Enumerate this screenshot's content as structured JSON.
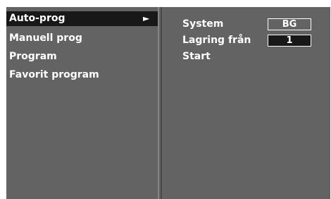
{
  "menu": {
    "items": [
      {
        "label": "Auto-prog",
        "selected": true,
        "arrow": "►"
      },
      {
        "label": "Manuell prog"
      },
      {
        "label": "Program"
      },
      {
        "label": "Favorit program"
      }
    ]
  },
  "settings": {
    "system": {
      "label": "System",
      "value": "BG"
    },
    "storage": {
      "label": "Lagring från",
      "value": "1"
    },
    "start": {
      "label": "Start"
    }
  },
  "colors": {
    "panel_bg": "#636363",
    "highlight": "#181818",
    "text": "#ffffff"
  }
}
